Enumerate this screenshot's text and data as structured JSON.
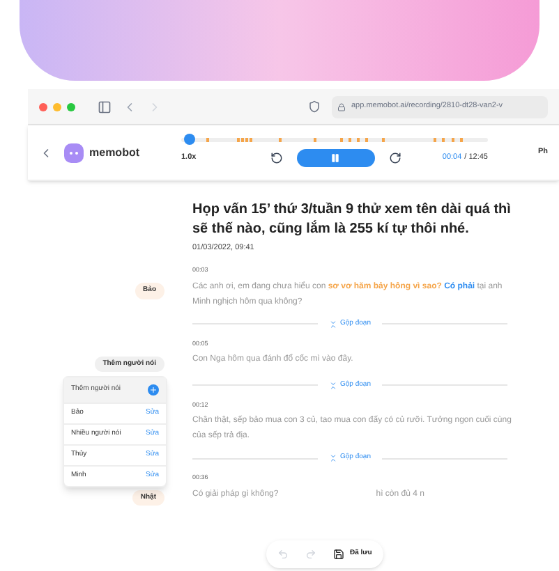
{
  "browser": {
    "url": "app.memobot.ai/recording/2810-dt28-van2-v"
  },
  "app": {
    "logo": "memobot",
    "speed": "1.0x",
    "time_current": "00:04",
    "time_total": "/ 12:45",
    "right_label": "Ph",
    "playing": true,
    "level": 0.02
  },
  "meeting": {
    "title": "Họp vấn 15’ thứ 3/tuần 9 thử xem tên dài quá thì sẽ thế nào, cũng lắm là 255 kí tự thôi nhé.",
    "date": "01/03/2022, 09:41"
  },
  "segments": [
    {
      "time": "00:03",
      "speaker": "Bảo",
      "color": "#fdf1e7",
      "text": "Các anh ơi, em đang chưa hiểu con **sơ vơ hăm bảy hông vì sao?** *Có phải* tại anh Minh nghịch hôm qua không?",
      "merge": "Gộp đoạn"
    },
    {
      "time": "00:05",
      "speaker": "Thêm người nói",
      "color": "#f0f0f0",
      "text": "Con Nga hôm qua đánh đổ cốc mì vào đây.",
      "merge": "Gộp đoạn"
    },
    {
      "time": "00:12",
      "text": "Chân thật, sếp bảo mua con 3 củ, tao mua con đấy có củ rưỡi. Tưởng ngon cuối cùng của sếp trả địa.",
      "merge": "Gộp đoạn"
    },
    {
      "time": "00:36",
      "speaker": "Nhật",
      "color": "#fdf1e7",
      "text": "Có giải pháp gì không?                                          hì còn đủ 4 n"
    }
  ],
  "speaker_menu": {
    "placeholder": "Thêm người nói",
    "items": [
      {
        "name": "Bảo",
        "action": "Sửa"
      },
      {
        "name": "Nhiều người nói",
        "action": "Sửa"
      },
      {
        "name": "Thủy",
        "action": "Sửa"
      },
      {
        "name": "Minh",
        "action": "Sửa"
      }
    ]
  },
  "toolbar": {
    "save": "Đã lưu"
  }
}
